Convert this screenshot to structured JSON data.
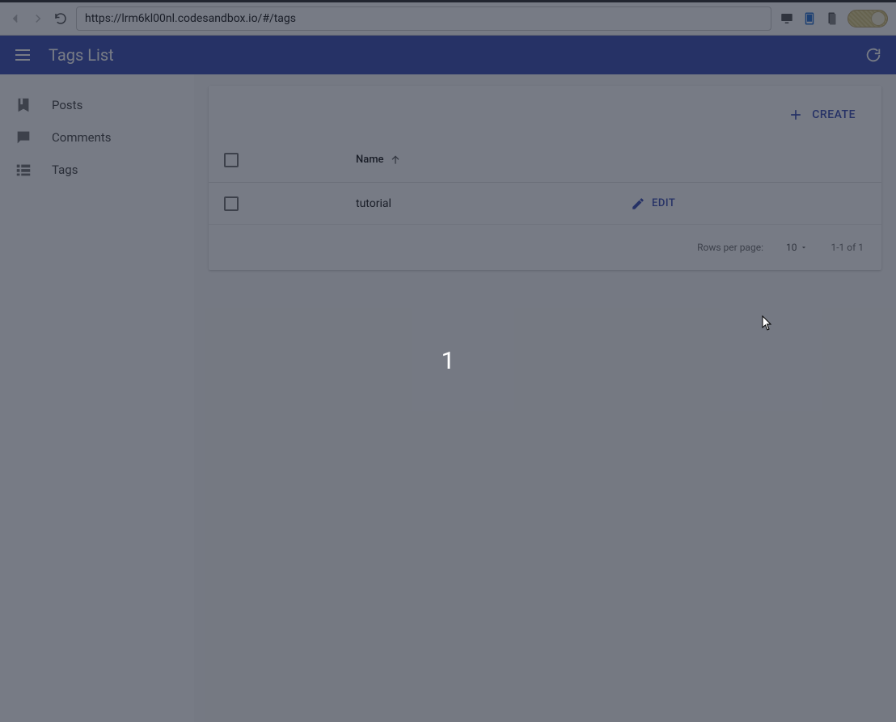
{
  "browser": {
    "url": "https://lrm6kl00nl.codesandbox.io/#/tags"
  },
  "header": {
    "title": "Tags List"
  },
  "sidebar": {
    "items": [
      {
        "label": "Posts"
      },
      {
        "label": "Comments"
      },
      {
        "label": "Tags"
      }
    ]
  },
  "toolbar": {
    "create_label": "CREATE"
  },
  "table": {
    "columns": {
      "name": "Name"
    },
    "rows": [
      {
        "name": "tutorial",
        "edit_label": "EDIT"
      }
    ]
  },
  "pagination": {
    "rows_per_page_label": "Rows per page:",
    "rows_per_page_value": "10",
    "range": "1-1 of 1"
  },
  "overlay": {
    "counter": "1"
  }
}
